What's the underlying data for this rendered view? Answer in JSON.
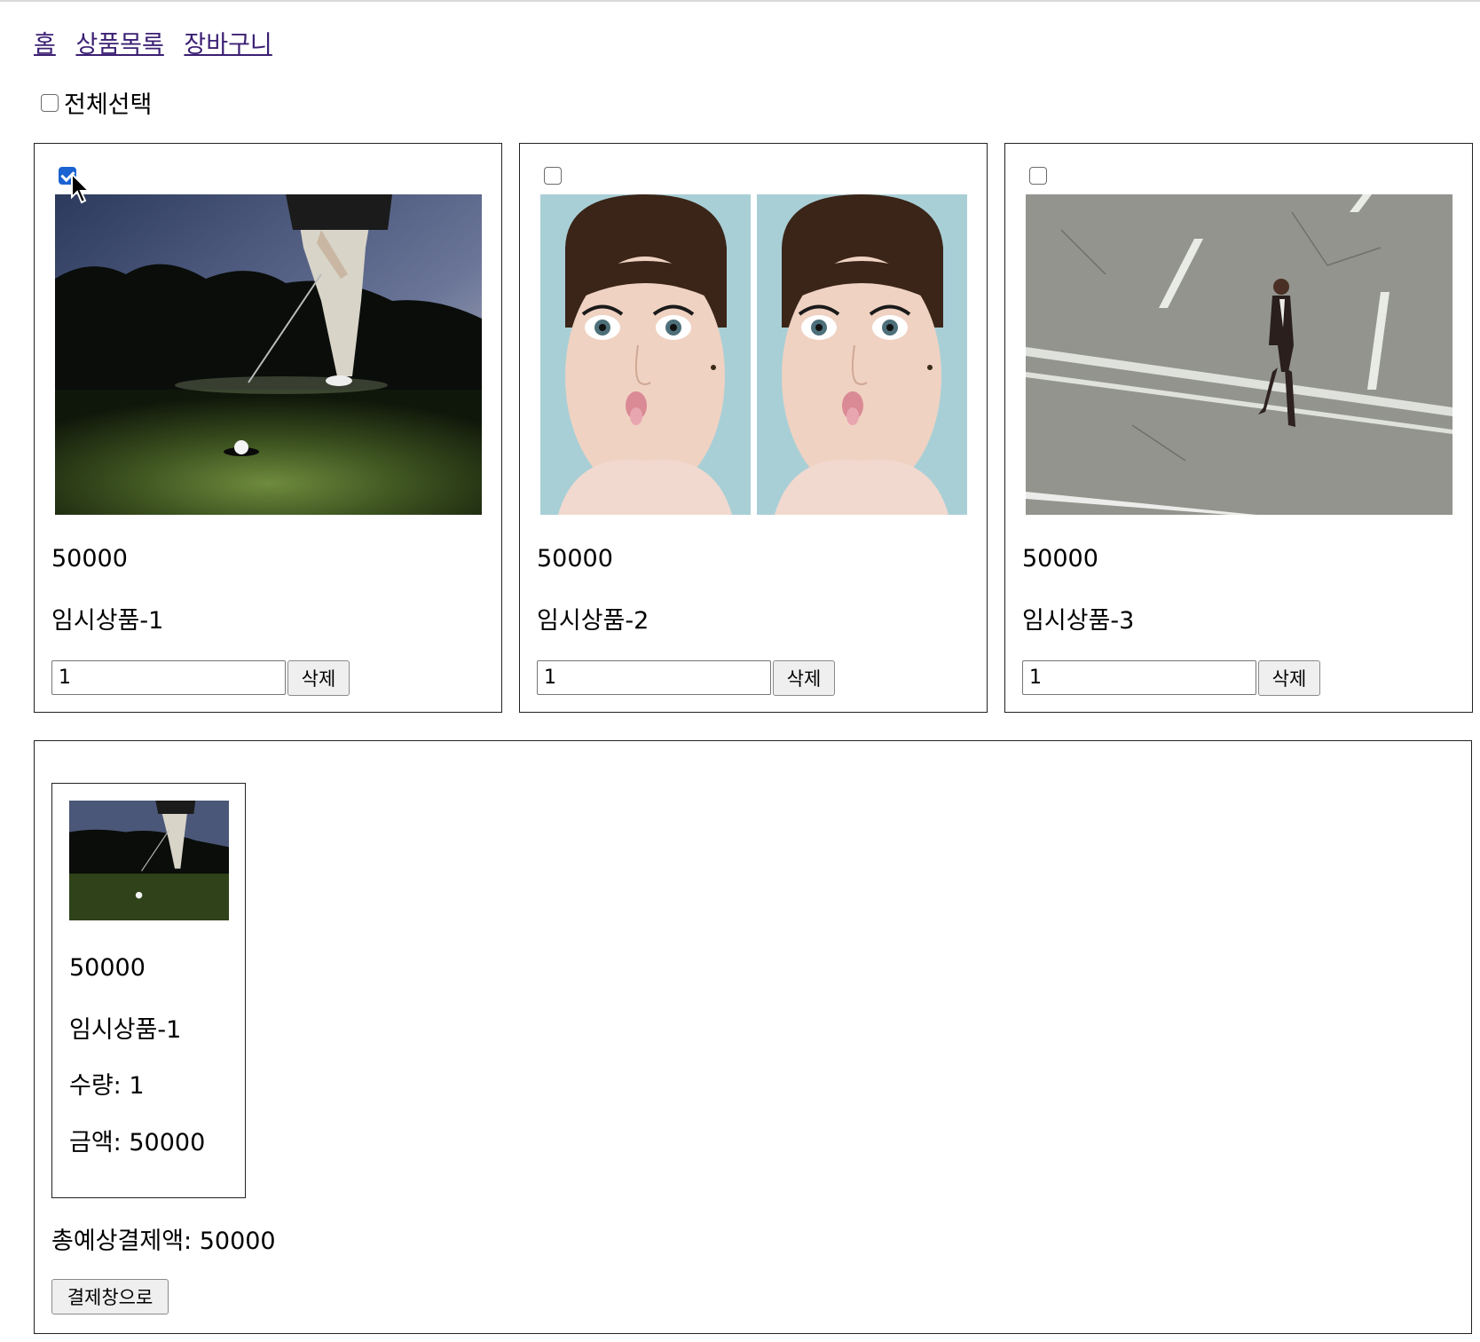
{
  "nav": {
    "home": "홈",
    "products": "상품목록",
    "cart": "장바구니"
  },
  "select_all": {
    "label": "전체선택",
    "checked": false
  },
  "products": [
    {
      "name": "임시상품-1",
      "price": "50000",
      "qty": "1",
      "delete_label": "삭제",
      "checked": true,
      "image": "golf-putt-photo"
    },
    {
      "name": "임시상품-2",
      "price": "50000",
      "qty": "1",
      "delete_label": "삭제",
      "checked": false,
      "image": "surprised-woman-photo"
    },
    {
      "name": "임시상품-3",
      "price": "50000",
      "qty": "1",
      "delete_label": "삭제",
      "checked": false,
      "image": "man-walking-road-photo"
    }
  ],
  "cart": {
    "items": [
      {
        "price": "50000",
        "name": "임시상품-1",
        "qty_text": "수량: 1",
        "amount_text": "금액: 50000",
        "image": "golf-putt-photo"
      }
    ],
    "total_text": "총예상결제액: 50000",
    "checkout_label": "결제창으로"
  },
  "colors": {
    "link": "#3b1f73",
    "checkbox_checked": "#1a63d1",
    "border": "#222222"
  }
}
